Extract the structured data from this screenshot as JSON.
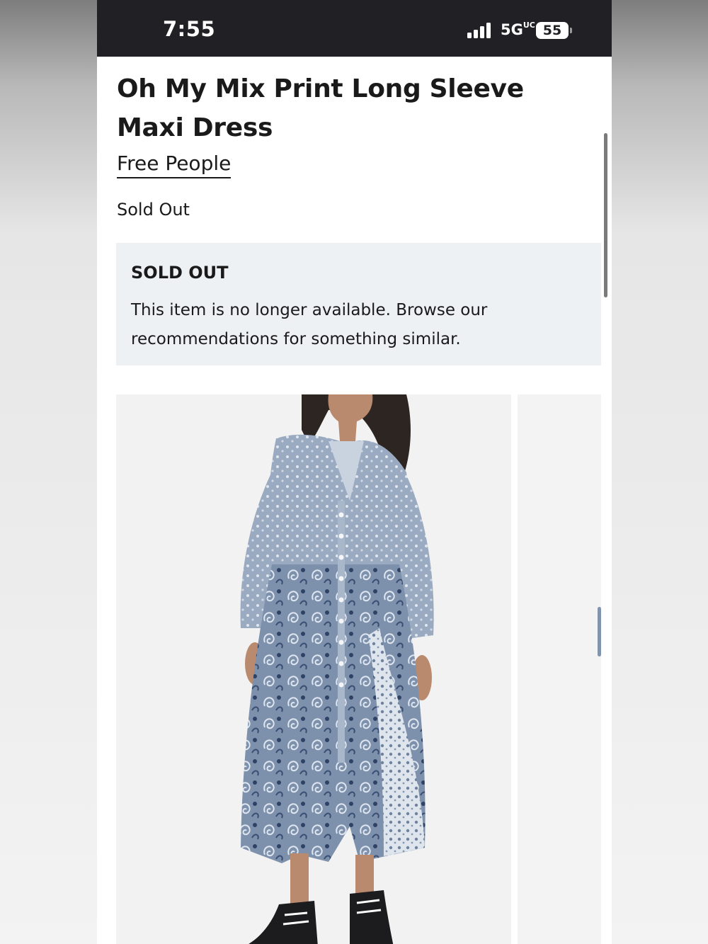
{
  "status_bar": {
    "time": "7:55",
    "network": "5G",
    "network_suffix": "UC",
    "battery": "55"
  },
  "product": {
    "title": "Oh My Mix Print Long Sleeve Maxi Dress",
    "brand": "Free People",
    "availability": "Sold Out"
  },
  "notice": {
    "heading": "SOLD OUT",
    "body": "This item is no longer available. Browse our recommendations for something similar."
  },
  "gallery": {
    "main_image": "model-in-blue-paisley-maxi-dress",
    "next_image": "partial-product-photo"
  },
  "colors": {
    "status_bar_bg": "#212125",
    "notice_bg": "#edf1f4",
    "dress_blue": "#8193ad",
    "text": "#1a1a1a"
  }
}
